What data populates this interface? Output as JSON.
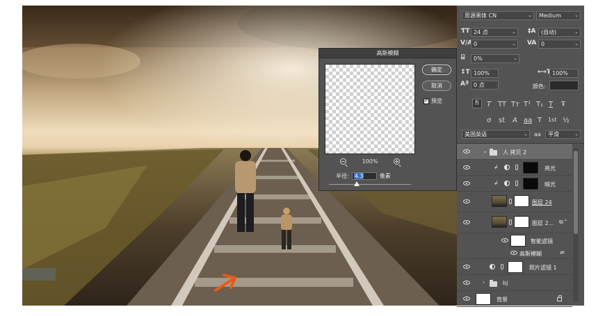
{
  "dialog": {
    "title": "高斯模糊",
    "ok_label": "确定",
    "cancel_label": "取消",
    "preview_label": "预览",
    "preview_checked": true,
    "zoom": "100%",
    "radius_label": "半径:",
    "radius_value": "4.3",
    "radius_unit": "像素"
  },
  "character": {
    "font_family": "思源黑体 CN",
    "font_style": "Medium",
    "font_size": "24 点",
    "leading": "(自动)",
    "kerning": "0",
    "tracking": "0",
    "scale_percent": "0%",
    "vertical_scale": "100%",
    "horizontal_scale": "100%",
    "baseline_shift": "0 点",
    "color_label": "颜色:",
    "language": "美国英语",
    "anti_alias_label": "aa",
    "anti_alias": "平滑",
    "style_glyphs": [
      "T",
      "T",
      "TT",
      "Tт",
      "T¹",
      "T₁",
      "T",
      "Ŧ"
    ],
    "opentype_glyphs": [
      "fi",
      "ơ",
      "st",
      "A",
      "aa",
      "T",
      "1st",
      "½"
    ]
  },
  "layers": [
    {
      "type": "group",
      "name": "人 拷贝 2",
      "expanded": true,
      "selected": true
    },
    {
      "type": "adjustment",
      "name": "亮光",
      "clipped": true
    },
    {
      "type": "adjustment",
      "name": "暗光",
      "clipped": true
    },
    {
      "type": "pixel",
      "name": "图层 24"
    },
    {
      "type": "smart",
      "name": "图层 2..."
    },
    {
      "type": "filter",
      "name": "智能滤镜"
    },
    {
      "type": "filter-item",
      "name": "高斯模糊"
    },
    {
      "type": "adjustment",
      "name": "照片滤镜 1"
    },
    {
      "type": "group",
      "name": "bj",
      "expanded": false
    },
    {
      "type": "background",
      "name": "背景",
      "locked": true
    }
  ],
  "colors": {
    "panel_bg": "#535353",
    "selection_blue": "#3b6fc1",
    "annotation_arrow": "#e85a1a"
  },
  "icons": [
    "zoom-out-icon",
    "zoom-in-icon",
    "eye-icon",
    "folder-icon",
    "lock-icon",
    "chain-link-icon",
    "adjustment-icon",
    "chevron-down-icon",
    "smart-object-icon"
  ]
}
